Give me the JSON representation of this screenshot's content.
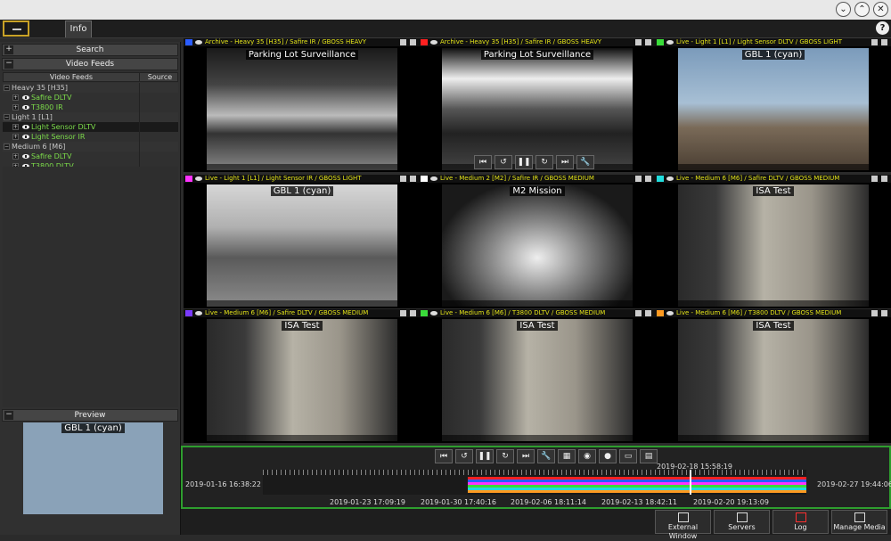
{
  "menubar": {
    "info_tab": "Info",
    "help": "?"
  },
  "window_controls": {
    "down": "⌄",
    "up": "⌃",
    "close": "✕"
  },
  "left_panel": {
    "search_label": "Search",
    "video_feeds_label": "Video Feeds",
    "columns": [
      "Video Feeds",
      "Source"
    ],
    "tree": [
      {
        "label": "Heavy 35 [H35]",
        "kind": "group"
      },
      {
        "label": "Safire DLTV",
        "kind": "feed"
      },
      {
        "label": "T3800 IR",
        "kind": "feed"
      },
      {
        "label": "Light 1 [L1]",
        "kind": "group"
      },
      {
        "label": "Light Sensor DLTV",
        "kind": "feed"
      },
      {
        "label": "Light Sensor IR",
        "kind": "feed"
      },
      {
        "label": "Medium 6 [M6]",
        "kind": "group"
      },
      {
        "label": "Safire DLTV",
        "kind": "feed"
      },
      {
        "label": "T3800 DLTV",
        "kind": "feed"
      }
    ],
    "preview_label": "Preview",
    "preview_overlay": "GBL 1 (cyan)"
  },
  "tiles": [
    {
      "label": "Archive - Heavy 35 [H35] / Safire IR / GBOSS HEAVY",
      "overlay": "Parking Lot Surveillance",
      "color": "#2a5cff",
      "style": "v-thermal"
    },
    {
      "label": "Archive - Heavy 35 [H35] / Safire IR / GBOSS HEAVY",
      "overlay": "Parking Lot Surveillance",
      "color": "#ff2020",
      "style": "v-thermal2"
    },
    {
      "label": "Live - Light 1 [L1] / Light Sensor DLTV / GBOSS LIGHT",
      "overlay": "GBL 1 (cyan)",
      "color": "#3adc3a",
      "style": "v-sky"
    },
    {
      "label": "Live - Light 1 [L1] / Light Sensor IR / GBOSS LIGHT",
      "overlay": "GBL 1 (cyan)",
      "color": "#ff33ff",
      "style": "v-grey"
    },
    {
      "label": "Live - Medium 2 [M2] / Safire IR / GBOSS MEDIUM",
      "overlay": "M2 Mission",
      "color": "#ffffff",
      "style": "v-night"
    },
    {
      "label": "Live - Medium 6 [M6] / Safire DLTV / GBOSS MEDIUM",
      "overlay": "ISA Test",
      "color": "#22dddd",
      "style": "v-lab"
    },
    {
      "label": "Live - Medium 6 [M6] / Safire DLTV / GBOSS MEDIUM",
      "overlay": "ISA Test",
      "color": "#7a3aff",
      "style": "v-lab"
    },
    {
      "label": "Live - Medium 6 [M6] / T3800 DLTV / GBOSS MEDIUM",
      "overlay": "ISA Test",
      "color": "#3adc3a",
      "style": "v-lab"
    },
    {
      "label": "Live - Medium 6 [M6] / T3800 DLTV / GBOSS MEDIUM",
      "overlay": "ISA Test",
      "color": "#ff9a20",
      "style": "v-lab"
    }
  ],
  "tile_playback_icons": [
    "⏮",
    "↺",
    "❚❚",
    "↻",
    "⏭",
    "🔧"
  ],
  "timeline_controls_icons": [
    "⏮",
    "↺",
    "❚❚",
    "↻",
    "⏭",
    "🔧",
    "▦",
    "◉",
    "●",
    "▭",
    "▤"
  ],
  "timeline": {
    "start": "2019-01-16 16:38:22",
    "end": "2019-02-27 19:44:06",
    "cursor": "2019-02-18 15:58:19",
    "ticks": [
      "2019-01-23 17:09:19",
      "2019-01-30 17:40:16",
      "2019-02-06 18:11:14",
      "2019-02-13 18:42:11",
      "2019-02-20 19:13:09"
    ],
    "band_colors": [
      "#ff2020",
      "#2a5cff",
      "#ff33ff",
      "#3adc3a",
      "#22dddd",
      "#ff9a20"
    ]
  },
  "bottom_toolbar": {
    "external_window": "External Window",
    "servers": "Servers",
    "log": "Log",
    "manage_media": "Manage Media"
  }
}
